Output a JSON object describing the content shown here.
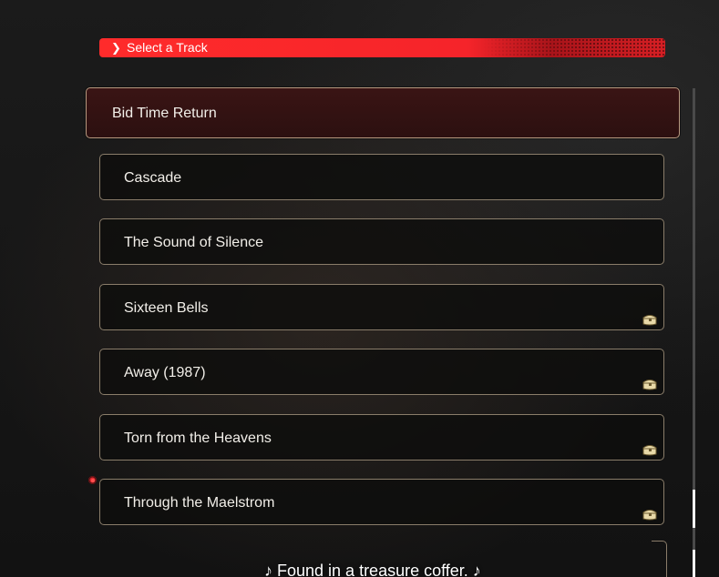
{
  "header": {
    "chevron": "❯",
    "title": "Select a Track",
    "accent_color": "#ff2b2b"
  },
  "tracks": [
    {
      "label": "Bid Time Return",
      "selected": true,
      "treasure": false
    },
    {
      "label": "Cascade",
      "selected": false,
      "treasure": false
    },
    {
      "label": "The Sound of Silence",
      "selected": false,
      "treasure": false
    },
    {
      "label": "Sixteen Bells",
      "selected": false,
      "treasure": true
    },
    {
      "label": "Away (1987)",
      "selected": false,
      "treasure": true
    },
    {
      "label": "Torn from the Heavens",
      "selected": false,
      "treasure": true
    },
    {
      "label": "Through the Maelstrom",
      "selected": false,
      "treasure": true,
      "new_marker": true
    }
  ],
  "icons": {
    "treasure": "treasure-chest-icon",
    "new": "new-indicator-dot"
  },
  "tooltip": {
    "text": "♪ Found in a treasure coffer. ♪"
  }
}
